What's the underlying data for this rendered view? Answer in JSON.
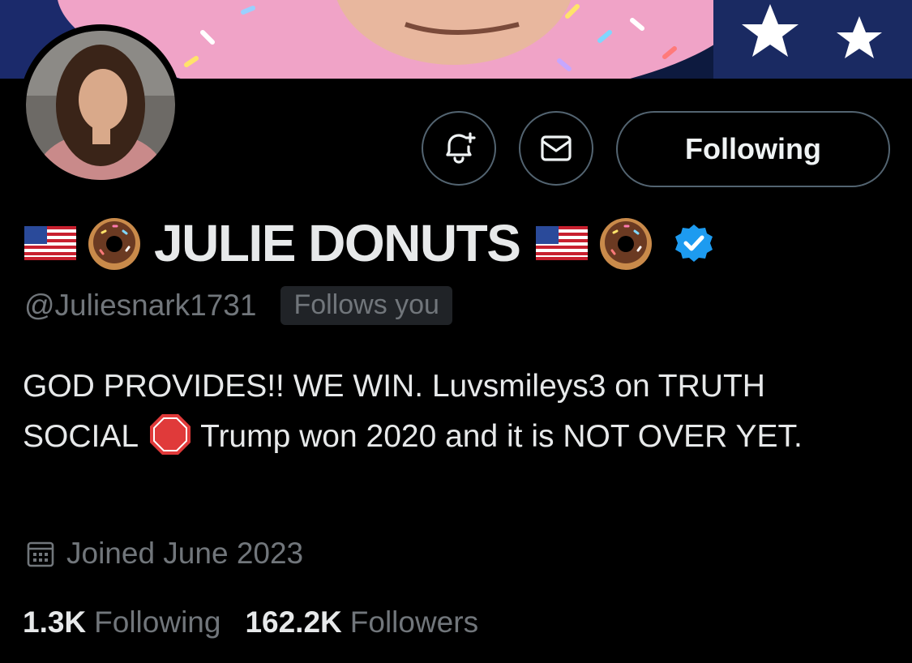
{
  "profile": {
    "display_name": "JULIE DONUTS",
    "handle": "@Juliesnark1731",
    "follows_you": "Follows you",
    "bio_part1": "GOD PROVIDES!! WE WIN. Luvsmileys3 on TRUTH SOCIAL",
    "bio_part2": "Trump won 2020 and it is NOT OVER YET.",
    "joined": "Joined June 2023",
    "verified": true
  },
  "actions": {
    "following_label": "Following",
    "notify_icon": "bell-plus-icon",
    "message_icon": "envelope-icon"
  },
  "stats": {
    "following_count": "1.3K",
    "following_label": "Following",
    "followers_count": "162.2K",
    "followers_label": "Followers"
  },
  "colors": {
    "background": "#000000",
    "text_primary": "#e7e9ea",
    "text_secondary": "#71767b",
    "border": "#536471",
    "verified_blue": "#1d9bf0"
  }
}
